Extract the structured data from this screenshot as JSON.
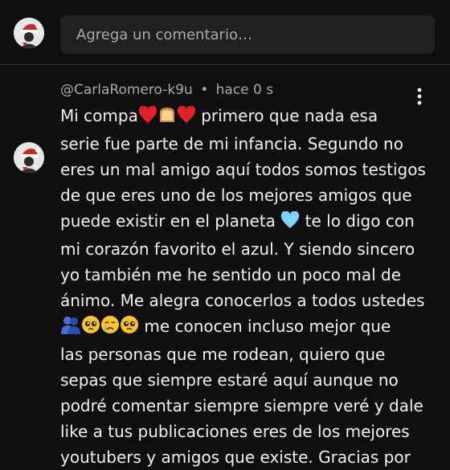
{
  "composer": {
    "placeholder": "Agrega un comentario…"
  },
  "comment": {
    "author": "@CarlaRomero-k9u",
    "separator": "•",
    "time": "hace 0 s",
    "lines": [
      {
        "a": "Mi compa",
        "emoji": [
          "red-heart",
          "bread",
          "red-heart"
        ],
        "b": " primero que nada esa"
      },
      {
        "a": "serie fue parte de mi infancia. Segundo no"
      },
      {
        "a": "eres un mal amigo aquí todos somos testigos"
      },
      {
        "a": "de que eres uno de los mejores amigos que"
      },
      {
        "a": "puede existir en el planeta ",
        "emoji": [
          "light-blue-heart"
        ],
        "b": " te lo digo con"
      },
      {
        "a": "mi corazón favorito el azul. Y siendo sincero"
      },
      {
        "a": "yo también me he sentido un poco mal de"
      },
      {
        "a": "ánimo. Me alegra conocerlos a todos ustedes"
      },
      {
        "a": "",
        "emoji": [
          "hugging-people",
          "pleading-face",
          "crying-face",
          "pleading-face"
        ],
        "b": " me conocen incluso mejor que"
      },
      {
        "a": "las personas que me rodean, quiero que"
      },
      {
        "a": "sepas que siempre estaré aquí aunque no"
      },
      {
        "a": "podré comentar siempre siempre veré y dale"
      },
      {
        "a": "like a tus publicaciones eres de los mejores"
      },
      {
        "a": "youtubers y amigos que existe. Gracias por"
      }
    ]
  },
  "icons": {
    "menu": "more-vert-icon",
    "avatar": "santa-hat-avatar-icon"
  },
  "colors": {
    "background": "#0f0f0f",
    "input_bg": "#212121",
    "text": "#f1f1f1",
    "muted": "#aaaaaa"
  }
}
